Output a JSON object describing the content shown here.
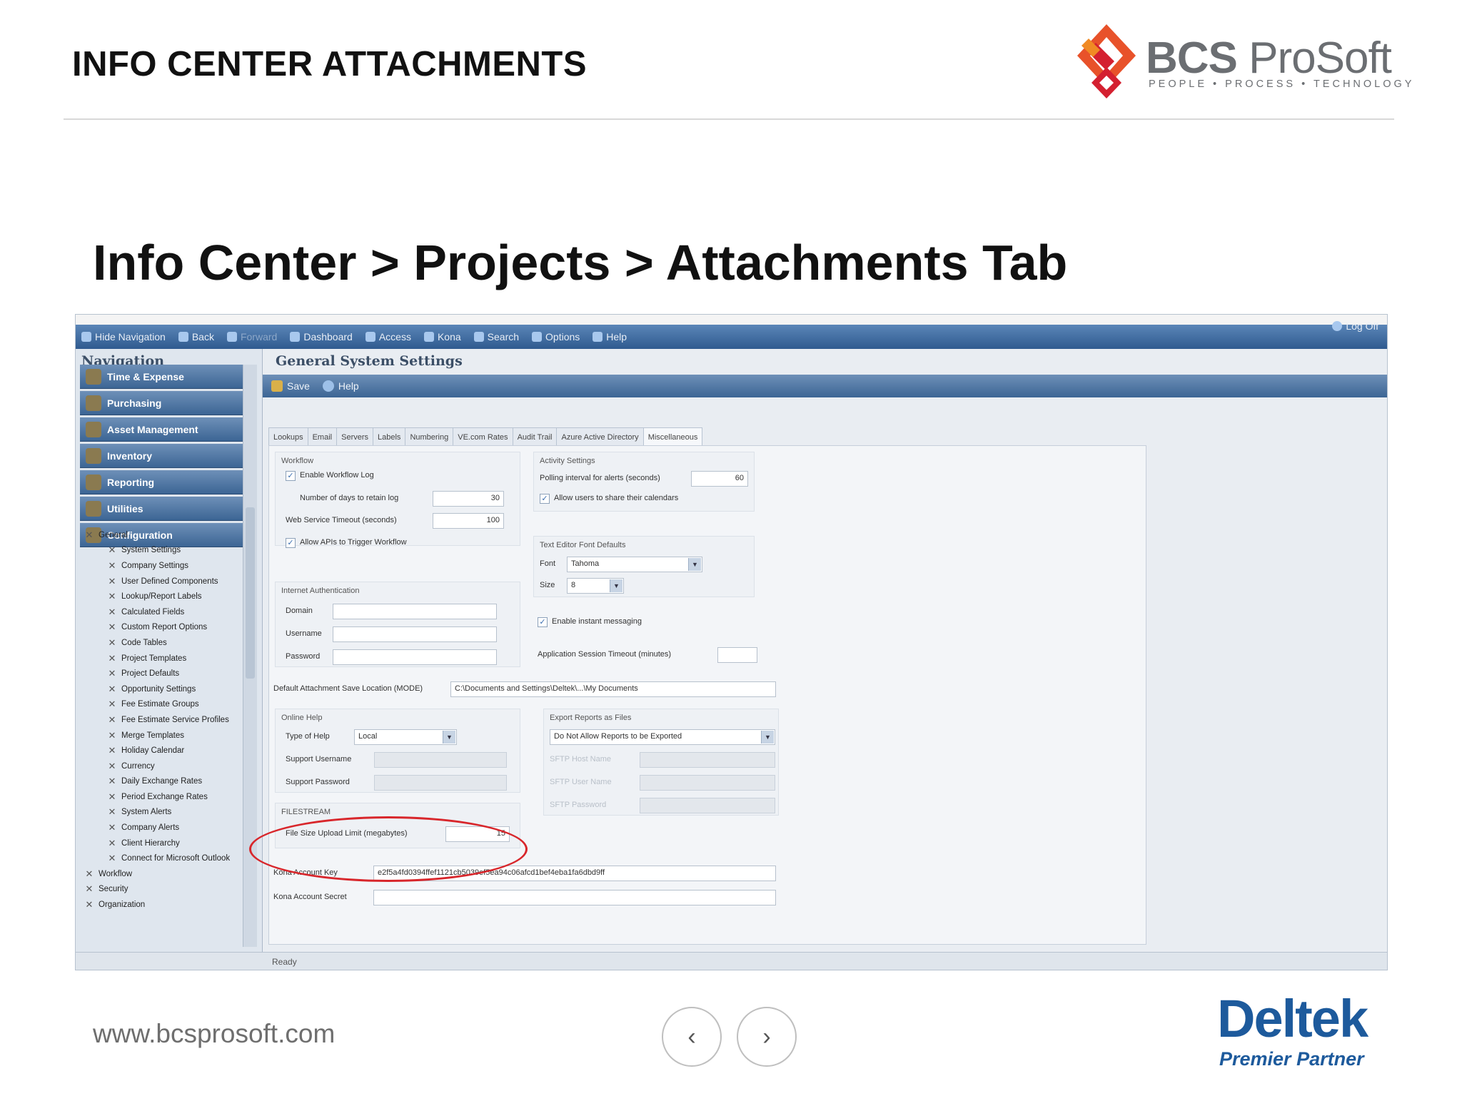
{
  "slide": {
    "title": "INFO CENTER ATTACHMENTS",
    "subtitle": "Info Center > Projects > Attachments Tab",
    "website": "www.bcsprosoft.com",
    "nav_prev": "‹",
    "nav_next": "›"
  },
  "logo": {
    "bcs": "BCS",
    "prosoft": "ProSoft",
    "tagline": "PEOPLE • PROCESS • TECHNOLOGY"
  },
  "deltek": {
    "name": "Deltek",
    "partner": "Premier Partner"
  },
  "app": {
    "toolbar": [
      {
        "label": "Hide Navigation",
        "icon": "hide-nav-icon"
      },
      {
        "label": "Back",
        "icon": "back-icon"
      },
      {
        "label": "Forward",
        "icon": "forward-icon"
      },
      {
        "label": "Dashboard",
        "icon": "dashboard-icon"
      },
      {
        "label": "Access",
        "icon": "access-icon"
      },
      {
        "label": "Kona",
        "icon": "kona-icon"
      },
      {
        "label": "Search",
        "icon": "search-icon"
      },
      {
        "label": "Options",
        "icon": "options-icon"
      },
      {
        "label": "Help",
        "icon": "help-icon"
      }
    ],
    "logoff": "Log Off",
    "navigation": {
      "title": "Navigation",
      "sections": [
        "Time & Expense",
        "Purchasing",
        "Asset Management",
        "Inventory",
        "Reporting",
        "Utilities",
        "Configuration"
      ],
      "tree": [
        {
          "label": "General",
          "level": 1
        },
        {
          "label": "System Settings",
          "level": 2
        },
        {
          "label": "Company Settings",
          "level": 2
        },
        {
          "label": "User Defined Components",
          "level": 2
        },
        {
          "label": "Lookup/Report Labels",
          "level": 2
        },
        {
          "label": "Calculated Fields",
          "level": 2
        },
        {
          "label": "Custom Report Options",
          "level": 2
        },
        {
          "label": "Code Tables",
          "level": 2
        },
        {
          "label": "Project Templates",
          "level": 2
        },
        {
          "label": "Project Defaults",
          "level": 2
        },
        {
          "label": "Opportunity Settings",
          "level": 2
        },
        {
          "label": "Fee Estimate Groups",
          "level": 2
        },
        {
          "label": "Fee Estimate Service Profiles",
          "level": 2
        },
        {
          "label": "Merge Templates",
          "level": 2
        },
        {
          "label": "Holiday Calendar",
          "level": 2
        },
        {
          "label": "Currency",
          "level": 2
        },
        {
          "label": "Daily Exchange Rates",
          "level": 2
        },
        {
          "label": "Period Exchange Rates",
          "level": 2
        },
        {
          "label": "System Alerts",
          "level": 2
        },
        {
          "label": "Company Alerts",
          "level": 2
        },
        {
          "label": "Client Hierarchy",
          "level": 2
        },
        {
          "label": "Connect for Microsoft Outlook",
          "level": 2
        },
        {
          "label": "Workflow",
          "level": 1
        },
        {
          "label": "Security",
          "level": 1
        },
        {
          "label": "Organization",
          "level": 1
        }
      ]
    },
    "main": {
      "title": "General System Settings",
      "save": "Save",
      "help": "Help",
      "tabs": [
        "Lookups",
        "Email",
        "Servers",
        "Labels",
        "Numbering",
        "VE.com Rates",
        "Audit Trail",
        "Azure Active Directory",
        "Miscellaneous"
      ],
      "workflow": {
        "title": "Workflow",
        "enable_log": "Enable Workflow Log",
        "days_label": "Number of days to retain log",
        "days_value": "30",
        "timeout_label": "Web Service Timeout (seconds)",
        "timeout_value": "100",
        "allow_apis": "Allow APIs to Trigger Workflow"
      },
      "activity": {
        "title": "Activity Settings",
        "polling_label": "Polling interval for alerts (seconds)",
        "polling_value": "60",
        "share_calendar": "Allow users to share their calendars"
      },
      "font": {
        "title": "Text Editor Font Defaults",
        "font_label": "Font",
        "font_value": "Tahoma",
        "size_label": "Size",
        "size_value": "8"
      },
      "internet_auth": {
        "title": "Internet Authentication",
        "domain": "Domain",
        "username": "Username",
        "password": "Password"
      },
      "instant_messaging": "Enable instant messaging",
      "session_timeout": "Application Session Timeout (minutes)",
      "attachment": {
        "label": "Default Attachment Save Location (MODE)",
        "value": "C:\\Documents and Settings\\Deltek\\...\\My Documents"
      },
      "online_help": {
        "title": "Online Help",
        "type_label": "Type of Help",
        "type_value": "Local",
        "support_username": "Support Username",
        "support_password": "Support Password"
      },
      "export": {
        "title": "Export Reports as Files",
        "value": "Do Not Allow Reports to be Exported",
        "sftp_host": "SFTP Host Name",
        "sftp_user": "SFTP User Name",
        "sftp_password": "SFTP Password"
      },
      "filestream": {
        "title": "FILESTREAM",
        "label": "File Size Upload Limit (megabytes)",
        "value": "15"
      },
      "kona": {
        "key_label": "Kona Account Key",
        "key_value": "e2f5a4fd0394ffef1121cb5039ef5ea94c06afcd1bef4eba1fa6dbd9ff",
        "secret_label": "Kona Account Secret"
      }
    },
    "status": "Ready"
  }
}
